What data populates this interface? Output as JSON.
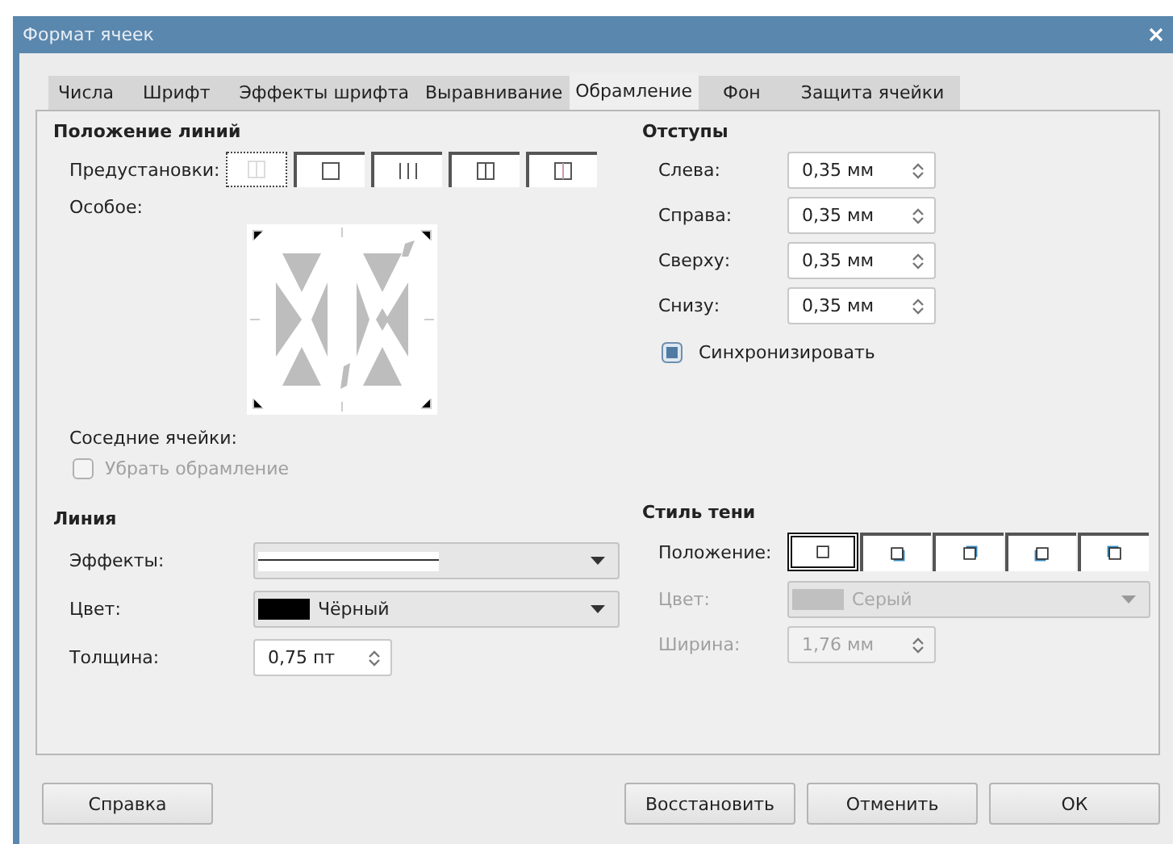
{
  "window": {
    "title": "Формат ячеек"
  },
  "tabs": [
    {
      "label": "Числа",
      "selected": false
    },
    {
      "label": "Шрифт",
      "selected": false
    },
    {
      "label": "Эффекты шрифта",
      "selected": false
    },
    {
      "label": "Выравнивание",
      "selected": false
    },
    {
      "label": "Обрамление",
      "selected": true
    },
    {
      "label": "Фон",
      "selected": false
    },
    {
      "label": "Защита ячейки",
      "selected": false
    }
  ],
  "line_arrangement": {
    "title": "Положение линий",
    "presets_label": "Предустановки:",
    "presets": [
      {
        "kind": "none",
        "selected": true
      },
      {
        "kind": "outer",
        "selected": false
      },
      {
        "kind": "inner",
        "selected": false
      },
      {
        "kind": "outer-inner",
        "selected": false
      },
      {
        "kind": "outer-only-vertical",
        "selected": false
      }
    ],
    "custom_label": "Особое:",
    "adjacent_label": "Соседние ячейки:",
    "adjacent_checkbox": {
      "label": "Убрать обрамление",
      "checked": false,
      "disabled": true
    }
  },
  "padding": {
    "title": "Отступы",
    "fields": [
      {
        "label": "Слева:",
        "value": "0,35 мм"
      },
      {
        "label": "Справа:",
        "value": "0,35 мм"
      },
      {
        "label": "Сверху:",
        "value": "0,35 мм"
      },
      {
        "label": "Снизу:",
        "value": "0,35 мм"
      }
    ],
    "sync": {
      "label": "Синхронизировать",
      "checked": true
    }
  },
  "line": {
    "title": "Линия",
    "effects": {
      "label": "Эффекты:"
    },
    "color": {
      "label": "Цвет:",
      "value": "Чёрный",
      "color": "#000000"
    },
    "width": {
      "label": "Толщина:",
      "value": "0,75 пт"
    }
  },
  "shadow": {
    "title": "Стиль тени",
    "position_label": "Положение:",
    "positions": [
      {
        "kind": "none",
        "selected": true
      },
      {
        "kind": "bottom-right",
        "selected": false
      },
      {
        "kind": "top-right",
        "selected": false
      },
      {
        "kind": "bottom-left",
        "selected": false
      },
      {
        "kind": "top-left",
        "selected": false
      }
    ],
    "color": {
      "label": "Цвет:",
      "value": "Серый",
      "color": "#c0c0c0",
      "disabled": true
    },
    "width": {
      "label": "Ширина:",
      "value": "1,76 мм",
      "disabled": true
    }
  },
  "buttons": [
    {
      "label": "Справка"
    },
    {
      "label": "Восстановить"
    },
    {
      "label": "Отменить"
    },
    {
      "label": "ОК"
    }
  ]
}
